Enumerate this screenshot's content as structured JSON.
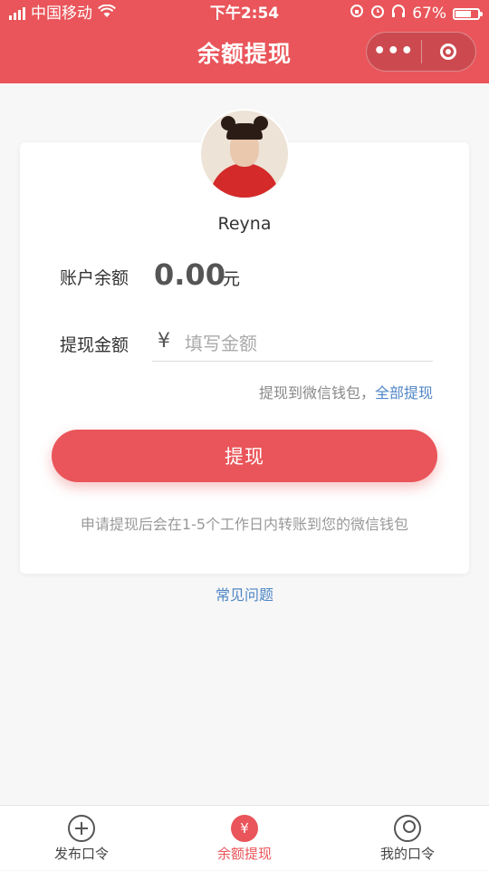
{
  "status_bar": {
    "carrier": "中国移动",
    "time": "下午2:54",
    "battery": "67%",
    "battery_level": 0.67
  },
  "header": {
    "title": "余额提现",
    "more_label": "•••"
  },
  "profile": {
    "username": "Reyna"
  },
  "balance": {
    "label": "账户余额",
    "value": "0.00",
    "unit": "元"
  },
  "withdraw": {
    "label": "提现金额",
    "currency_symbol": "¥",
    "placeholder": "填写金额",
    "value": "",
    "tip_text": "提现到微信钱包，",
    "withdraw_all": "全部提现",
    "button_label": "提现",
    "note": "申请提现后会在1-5个工作日内转账到您的微信钱包"
  },
  "faq_link": "常见问题",
  "tabbar": {
    "items": [
      {
        "label": "发布口令",
        "icon": "plus-circle-icon",
        "active": false
      },
      {
        "label": "余额提现",
        "icon": "coin-icon",
        "active": true
      },
      {
        "label": "我的口令",
        "icon": "person-icon",
        "active": false
      }
    ]
  },
  "colors": {
    "accent": "#e9555a",
    "link": "#4f86c6"
  }
}
